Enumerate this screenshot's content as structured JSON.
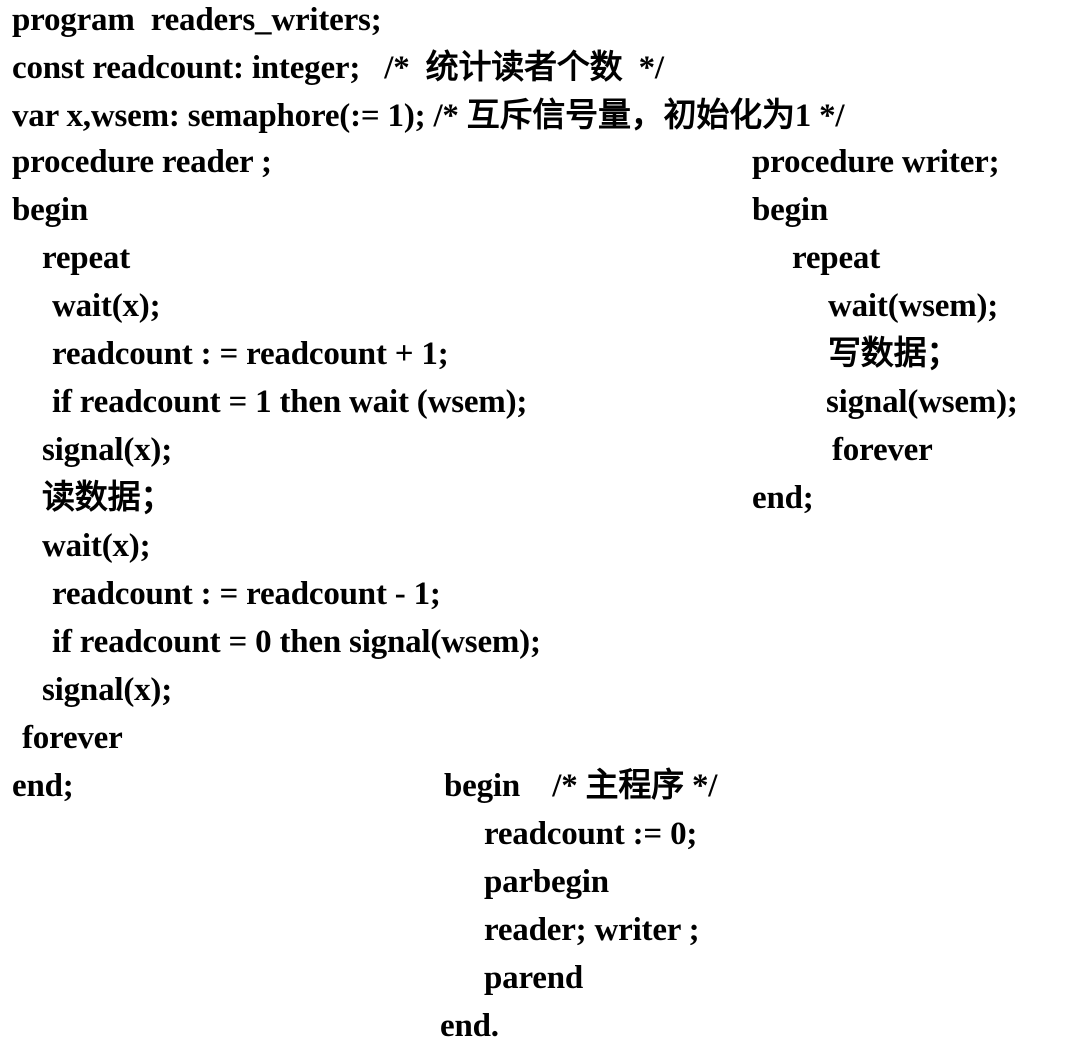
{
  "header": {
    "program": "program  readers_writers;",
    "const": "const readcount: integer;   /*  统计读者个数  */",
    "var": "var x,wsem: semaphore(:= 1); /* 互斥信号量，初始化为1 */"
  },
  "reader": [
    "procedure reader ;",
    "begin",
    "repeat",
    "wait(x);",
    "readcount : = readcount + 1;",
    "if readcount = 1 then wait (wsem);",
    "signal(x);",
    "读数据；",
    "wait(x);",
    "readcount : = readcount - 1;",
    "if readcount = 0 then signal(wsem);",
    "signal(x);",
    "forever",
    "end;"
  ],
  "writer": [
    "procedure writer;",
    "begin",
    "repeat",
    "wait(wsem);",
    "写数据；",
    "signal(wsem);",
    "forever",
    "end;"
  ],
  "main": [
    "begin    /* 主程序 */",
    "readcount := 0;",
    "parbegin",
    "reader; writer ;",
    "parend",
    "end."
  ]
}
